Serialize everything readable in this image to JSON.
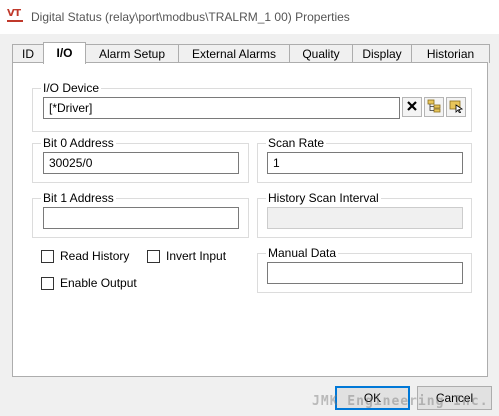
{
  "window": {
    "title": "Digital Status (relay\\port\\modbus\\TRALRM_1 00) Properties",
    "app_icon_text": "VT"
  },
  "tabs": [
    {
      "label": "ID",
      "active": false
    },
    {
      "label": "I/O",
      "active": true
    },
    {
      "label": "Alarm Setup",
      "active": false
    },
    {
      "label": "External Alarms",
      "active": false
    },
    {
      "label": "Quality",
      "active": false
    },
    {
      "label": "Display",
      "active": false
    },
    {
      "label": "Historian",
      "active": false
    }
  ],
  "io_device": {
    "label": "I/O Device",
    "value": "[*Driver]"
  },
  "bit0_address": {
    "label": "Bit 0 Address",
    "value": "30025/0"
  },
  "scan_rate": {
    "label": "Scan Rate",
    "value": "1"
  },
  "bit1_address": {
    "label": "Bit 1 Address",
    "value": ""
  },
  "history_scan_interval": {
    "label": "History Scan Interval",
    "value": ""
  },
  "checkboxes": {
    "read_history": {
      "label": "Read History",
      "checked": false
    },
    "invert_input": {
      "label": "Invert Input",
      "checked": false
    },
    "enable_output": {
      "label": "Enable Output",
      "checked": false
    }
  },
  "manual_data": {
    "label": "Manual Data",
    "value": ""
  },
  "buttons": {
    "ok": "OK",
    "cancel": "Cancel"
  },
  "watermark": "JMK Engineering Inc.",
  "colors": {
    "accent": "#0078d7",
    "icon_red": "#c0392b",
    "folder_yellow": "#e8c55a"
  },
  "icons": {
    "clear": "close-x-icon",
    "browse_tree": "tree-browse-icon",
    "browse_select": "folder-select-icon"
  }
}
